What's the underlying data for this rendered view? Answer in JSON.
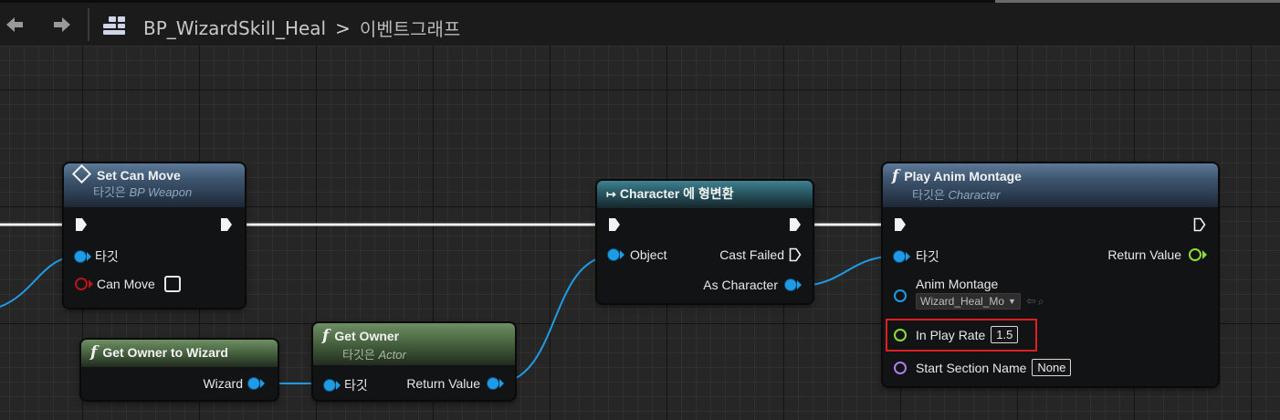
{
  "toolbar": {
    "breadcrumb_blueprint": "BP_WizardSkill_Heal",
    "breadcrumb_separator": ">",
    "breadcrumb_graph": "이벤트그래프",
    "icons": {
      "back": "arrow-left-icon",
      "forward": "arrow-right-icon",
      "blueprint": "blueprint-icon"
    }
  },
  "nodes": {
    "set_can_move": {
      "title": "Set Can Move",
      "subtitle_prefix": "타깃은",
      "subtitle_target": "BP Weapon",
      "pin_target": "타깃",
      "pin_can_move": "Can Move",
      "can_move_checked": false
    },
    "get_owner_to_wizard": {
      "title": "Get Owner to Wizard",
      "pin_wizard": "Wizard"
    },
    "get_owner": {
      "title": "Get Owner",
      "subtitle_prefix": "타깃은",
      "subtitle_target": "Actor",
      "pin_target": "타깃",
      "pin_return": "Return Value"
    },
    "cast_character": {
      "title": "Character 에 형변환",
      "pin_object": "Object",
      "pin_cast_failed": "Cast Failed",
      "pin_as_character": "As Character"
    },
    "play_anim_montage": {
      "title": "Play Anim Montage",
      "subtitle_prefix": "타깃은",
      "subtitle_target": "Character",
      "pin_target": "타깃",
      "pin_return": "Return Value",
      "pin_anim_montage": "Anim Montage",
      "anim_montage_value": "Wizard_Heal_Mo",
      "pin_in_play_rate": "In Play Rate",
      "in_play_rate_value": "1.5",
      "pin_start_section": "Start Section Name",
      "start_section_value": "None"
    }
  },
  "colors": {
    "exec_wire": "#f2f2f2",
    "object_wire": "#1f9be6",
    "float_pin": "#8fdc3c",
    "name_pin": "#b07cf0",
    "bool_pin": "#b71616",
    "highlight": "#e0201f"
  }
}
